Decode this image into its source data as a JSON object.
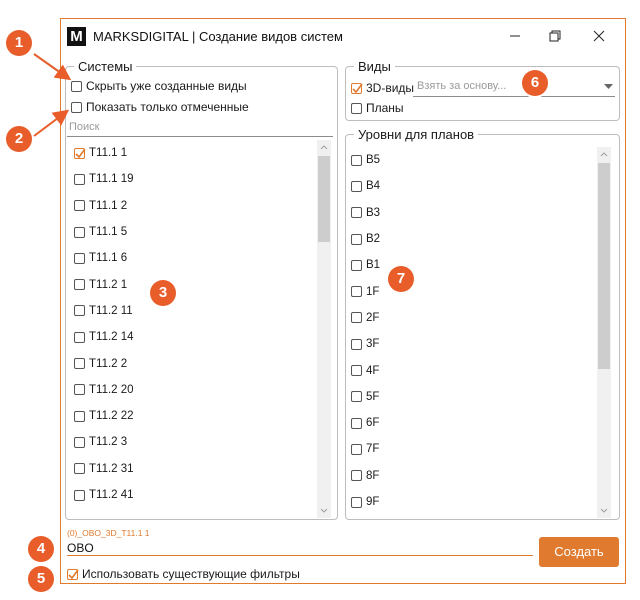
{
  "window": {
    "logo_letter": "M",
    "title": "MARKSDIGITAL | Создание видов систем"
  },
  "systems": {
    "legend": "Системы",
    "hide_created_label": "Скрыть уже созданные виды",
    "show_checked_label": "Показать только отмеченные",
    "search_placeholder": "Поиск",
    "items": [
      {
        "label": "T11.1 1",
        "checked": true
      },
      {
        "label": "T11.1 19",
        "checked": false
      },
      {
        "label": "T11.1 2",
        "checked": false
      },
      {
        "label": "T11.1 5",
        "checked": false
      },
      {
        "label": "T11.1 6",
        "checked": false
      },
      {
        "label": "T11.2 1",
        "checked": false
      },
      {
        "label": "T11.2 11",
        "checked": false
      },
      {
        "label": "T11.2 14",
        "checked": false
      },
      {
        "label": "T11.2 2",
        "checked": false
      },
      {
        "label": "T11.2 20",
        "checked": false
      },
      {
        "label": "T11.2 22",
        "checked": false
      },
      {
        "label": "T11.2 3",
        "checked": false
      },
      {
        "label": "T11.2 31",
        "checked": false
      },
      {
        "label": "T11.2 41",
        "checked": false
      }
    ]
  },
  "views": {
    "legend": "Виды",
    "threed_label": "3D-виды",
    "threed_checked": true,
    "base_placeholder": "Взять за основу...",
    "plans_label": "Планы",
    "plans_checked": false
  },
  "levels": {
    "legend": "Уровни для планов",
    "items": [
      "B5",
      "B4",
      "B3",
      "B2",
      "B1",
      "1F",
      "2F",
      "3F",
      "4F",
      "5F",
      "6F",
      "7F",
      "8F",
      "9F"
    ]
  },
  "footer": {
    "filename_preview": "(0)_OBO_3D_T11.1 1",
    "prefix_value": "OBO",
    "create_label": "Создать",
    "use_filters_label": "Использовать существующие фильтры",
    "use_filters_checked": true
  },
  "callouts": [
    "1",
    "2",
    "3",
    "4",
    "5",
    "6",
    "7"
  ],
  "colors": {
    "accent": "#e07a2e",
    "callout": "#e85d2a"
  },
  "icons": [
    "minimize-icon",
    "maximize-icon",
    "close-icon",
    "check-icon",
    "chevron-down-icon",
    "scroll-up-icon",
    "scroll-down-icon"
  ]
}
